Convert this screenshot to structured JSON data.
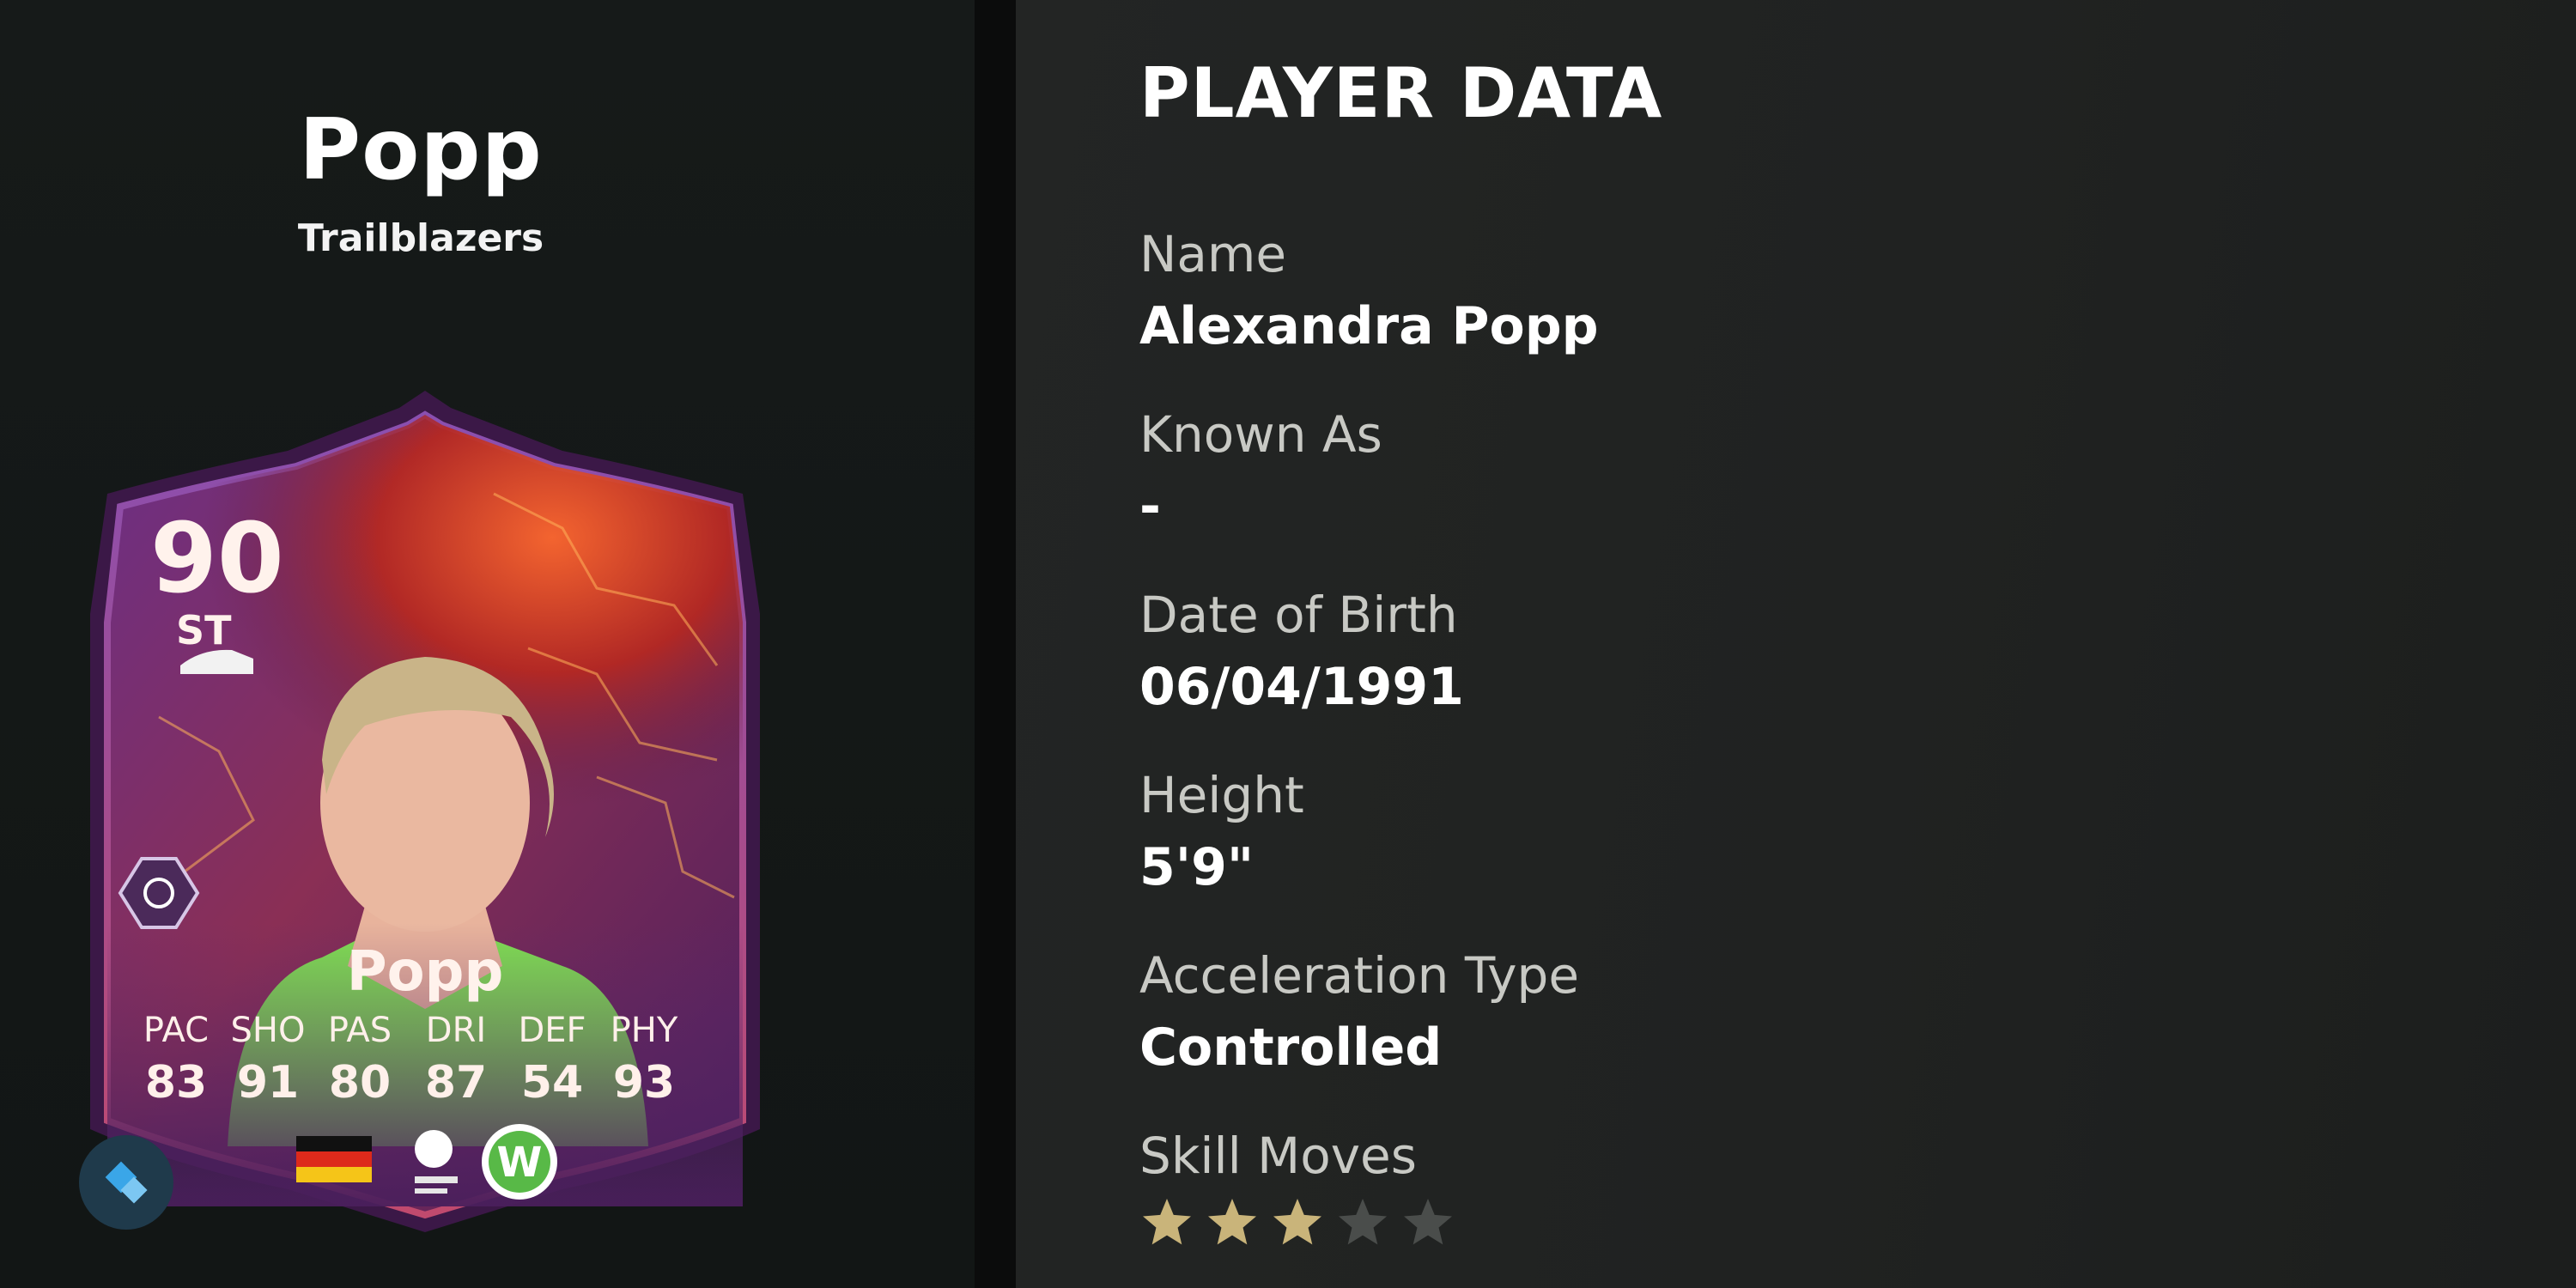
{
  "card_header": {
    "title": "Popp",
    "subtitle": "Trailblazers"
  },
  "card": {
    "rating": "90",
    "position": "ST",
    "name": "Popp",
    "stats": [
      {
        "label": "PAC",
        "value": "83"
      },
      {
        "label": "SHO",
        "value": "91"
      },
      {
        "label": "PAS",
        "value": "80"
      },
      {
        "label": "DRI",
        "value": "87"
      },
      {
        "label": "DEF",
        "value": "54"
      },
      {
        "label": "PHY",
        "value": "93"
      }
    ],
    "icons": [
      "boot-icon",
      "playstyle-icon",
      "germany-flag-icon",
      "league-logo-icon",
      "club-badge-icon",
      "app-logo-icon"
    ],
    "club_badge_letter": "W"
  },
  "player_data": {
    "title": "PLAYER DATA",
    "fields": [
      {
        "label": "Name",
        "value": "Alexandra Popp"
      },
      {
        "label": "Known As",
        "value": "-"
      },
      {
        "label": "Date of Birth",
        "value": "06/04/1991"
      },
      {
        "label": "Height",
        "value": "5'9\""
      },
      {
        "label": "Acceleration Type",
        "value": "Controlled"
      }
    ],
    "skill_moves": {
      "label": "Skill Moves",
      "rating": 3,
      "max": 5
    }
  },
  "colors": {
    "star_filled": "#c9b47a",
    "star_empty": "#4a4d4b",
    "card_purple": "#5b2a6e",
    "card_red": "#e2472b",
    "kit_green": "#7fe052"
  }
}
